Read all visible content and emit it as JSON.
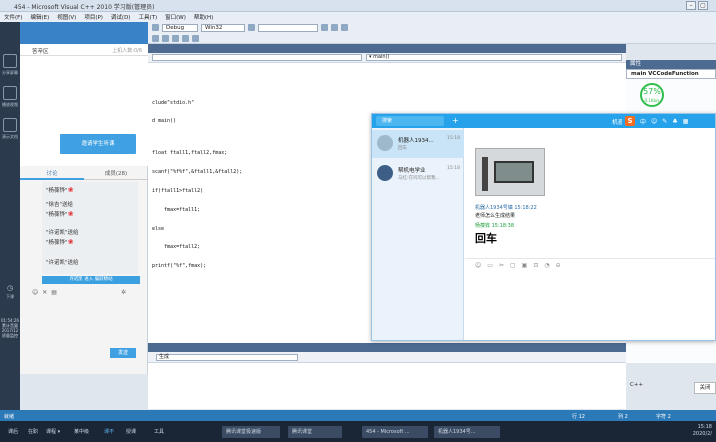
{
  "window": {
    "title": "454 - Microsoft Visual C++ 2010 学习版(管理员)",
    "controls": [
      "–",
      "▢"
    ]
  },
  "menu": [
    "文件(F)",
    "编辑(E)",
    "视图(V)",
    "项目(P)",
    "调试(D)",
    "工具(T)",
    "窗口(W)",
    "帮助(H)"
  ],
  "toolbar": {
    "config": "Debug",
    "platform": "Win32"
  },
  "classroom": {
    "side_labels": [
      "分享屏幕",
      "播放视频",
      "演示文档"
    ],
    "mode_label": "答辛区",
    "online_count": "上机人数:0/6",
    "invite_button": "邀请学生听课",
    "tabs": [
      "讨论",
      "成员(28)"
    ],
    "messages": [
      {
        "user": "\"杨葆铧\"",
        "note": ""
      },
      {
        "user": "\"徐吉\"送给",
        "note": ""
      },
      {
        "user": "\"杨葆铧\"",
        "note": ""
      },
      {
        "user": "\"许诺凯\"送给",
        "note": ""
      },
      {
        "user": "\"杨葆铧\"",
        "note": ""
      },
      {
        "user": "\"许诺凯\"送给",
        "note": ""
      }
    ],
    "mic_notice": "许诺凯 进入 偏跃精站",
    "send_button": "发送",
    "timer": "01:54:26",
    "stats": [
      "累计音量",
      "2017/12",
      "质量监控"
    ],
    "exit_label": "下课"
  },
  "editor": {
    "function_combo": "▾ main()",
    "code_lines": [
      "clude\"stdio.h\"",
      "d main()",
      "",
      "float ftall1,ftall2,fmax;",
      "scanf(\"%f%f\",&ftall1,&ftall2);",
      "if(ftall1>ftall2)",
      "    fmax=ftall1;",
      "else",
      "    fmax=ftall2;",
      "printf(\"%f\",fmax);"
    ]
  },
  "output": {
    "source_combo": "生成",
    "lang": "C++",
    "close_label": "关闭"
  },
  "properties": {
    "header": "属性",
    "combo": "main VCCodeFunction",
    "speed_percent": "57",
    "speed_sub": "0.1Kb/s"
  },
  "qq": {
    "search_placeholder": "搜索",
    "chat_name": "机器人1934号俳",
    "contacts": [
      {
        "name": "机器人1934...",
        "time": "15:18",
        "sub": "回车"
      },
      {
        "name": "帮机电学业",
        "time": "15:18",
        "sub": "马红:在吗可以帮我..."
      }
    ],
    "messages": [
      {
        "meta": "机器人1934号镇 15:18:22",
        "text": "老师怎么生成结果"
      },
      {
        "meta": "杨葆铧 15:18:38",
        "text": ""
      }
    ],
    "big_text": "回车"
  },
  "status": {
    "left": "就绪",
    "line": "行 12",
    "col": "列 2",
    "char": "字符 2"
  },
  "taskbar": {
    "items": [
      "腾讯课堂极速版",
      "腾讯课堂",
      "454 - Microsoft ...",
      "机器人1934号..."
    ],
    "left_labels": [
      "课后",
      "在职",
      "课程 ▾",
      "某中级",
      "课不",
      "授课",
      "工具"
    ],
    "time": "15:18",
    "date": "2020/2/"
  }
}
